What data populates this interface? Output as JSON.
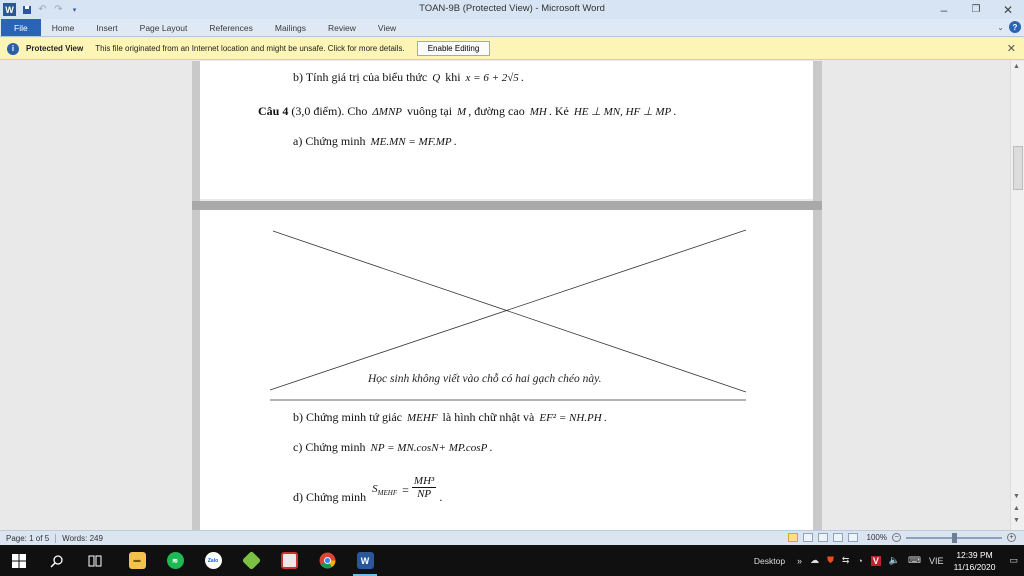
{
  "window": {
    "title": "TOAN-9B (Protected View)  -  Microsoft Word",
    "app_icon": "W",
    "controls": {
      "minimize": "–",
      "maximize": "❐",
      "close": "✕"
    }
  },
  "ribbon": {
    "tabs": [
      "File",
      "Home",
      "Insert",
      "Page Layout",
      "References",
      "Mailings",
      "Review",
      "View"
    ]
  },
  "protected_view": {
    "title": "Protected View",
    "message": "This file originated from an Internet location and might be unsafe. Click for more details.",
    "button": "Enable Editing"
  },
  "document": {
    "p1": {
      "prefix": "b) Tính giá trị của biểu thức",
      "math1": "Q",
      "mid": "khi",
      "math2": "x = 6 + 2√5",
      "suffix": "."
    },
    "p2": {
      "bold": "Câu 4",
      "a": "(3,0 điểm). Cho",
      "m1": "ΔMNP",
      "b": "vuông tại",
      "m2": "M",
      "c": ", đường cao",
      "m3": "MH",
      "d": ". Kẻ",
      "m4": "HE ⊥ MN, HF ⊥ MP",
      "e": "."
    },
    "p3": {
      "prefix": "a) Chứng minh",
      "math": "ME.MN = MF.MP",
      "suffix": "."
    },
    "note": "Học sinh không viết vào chỗ có hai gạch chéo này.",
    "p4": {
      "prefix": "b) Chứng minh tứ giác",
      "m1": "MEHF",
      "mid": "là hình chữ nhật và",
      "m2": "EF² = NH.PH",
      "suffix": "."
    },
    "p5": {
      "prefix": "c) Chứng minh",
      "math": "NP = MN.cosN+ MP.cosP",
      "suffix": "."
    },
    "p6": {
      "prefix": "d) Chứng minh",
      "lhs": "S",
      "sub": "MEHF",
      "eq": "=",
      "num": "MH³",
      "den": "NP",
      "suffix": "."
    }
  },
  "status": {
    "page": "Page: 1 of 5",
    "words": "Words: 249",
    "zoom": "100%"
  },
  "taskbar": {
    "apps": [
      "file-explorer",
      "spotify",
      "zalo",
      "bluestacks",
      "paint",
      "chrome",
      "word"
    ],
    "desktop_label": "Desktop",
    "lang": "VIE",
    "time": "12:39 PM",
    "date": "11/16/2020"
  }
}
